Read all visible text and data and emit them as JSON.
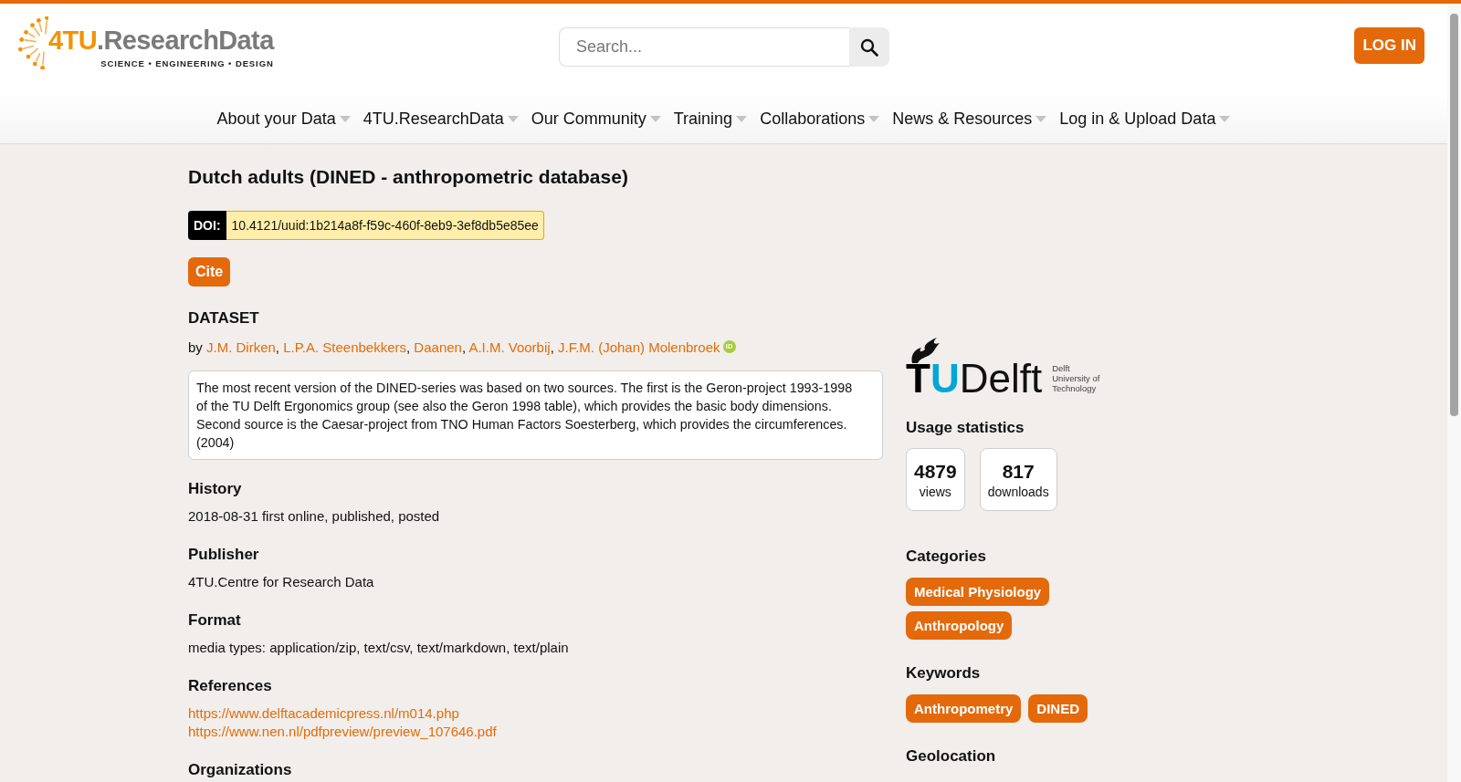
{
  "header": {
    "logo": {
      "mark": "4TU",
      "name": ".ResearchData",
      "tagline": "SCIENCE • ENGINEERING • DESIGN"
    },
    "search": {
      "placeholder": "Search..."
    },
    "login_button": "LOG IN"
  },
  "nav_menu": [
    "About your Data",
    "4TU.ResearchData",
    "Our Community",
    "Training",
    "Collaborations",
    "News & Resources",
    "Log in & Upload Data"
  ],
  "dataset": {
    "title": "Dutch adults (DINED - anthropometric database)",
    "doi": {
      "label": "DOI:",
      "value": "10.4121/uuid:1b214a8f-f59c-460f-8eb9-3ef8db5e85ee"
    },
    "cite_button": "Cite",
    "type_heading": "DATASET",
    "byline": {
      "prefix": "by",
      "separator": ",",
      "authors": [
        {
          "name": "J.M. Dirken"
        },
        {
          "name": "L.P.A. Steenbekkers"
        },
        {
          "name": "Daanen"
        },
        {
          "name": "A.I.M. Voorbij"
        },
        {
          "name": "J.F.M. (Johan) Molenbroek",
          "orcid_badge": "iD"
        }
      ]
    },
    "description": "The most recent version of the DINED-series was based on two sources. The first is the Geron-project 1993-1998 of the TU Delft Ergonomics group (see also the Geron 1998 table), which provides the basic body dimensions. Second source is the Caesar-project from TNO Human Factors Soesterberg, which provides the circumferences. (2004)",
    "sections": [
      {
        "kind": "text",
        "heading": "History",
        "text": "2018-08-31 first online, published, posted"
      },
      {
        "kind": "text",
        "heading": "Publisher",
        "text": "4TU.Centre for Research Data"
      },
      {
        "kind": "text",
        "heading": "Format",
        "text": "media types: application/zip, text/csv, text/markdown, text/plain"
      },
      {
        "kind": "links",
        "heading": "References",
        "links": [
          "https://www.delftacademicpress.nl/m014.php",
          "https://www.nen.nl/pdfpreview/preview_107646.pdf"
        ]
      },
      {
        "kind": "heading",
        "heading": "Organizations"
      }
    ]
  },
  "sidebar": {
    "institution_logo": {
      "initials_dark": "T",
      "initials_accent": "U",
      "name": "Delft",
      "subtitle_lines": [
        "Delft",
        "University of",
        "Technology"
      ]
    },
    "sections": [
      {
        "kind": "stats",
        "heading": "Usage statistics",
        "stats": [
          {
            "value": "4879",
            "label": "views"
          },
          {
            "value": "817",
            "label": "downloads"
          }
        ]
      },
      {
        "kind": "tags",
        "heading": "Categories",
        "tags": [
          "Medical Physiology",
          "Anthropology"
        ]
      },
      {
        "kind": "tags",
        "heading": "Keywords",
        "tags": [
          "Anthropometry",
          "DINED"
        ]
      },
      {
        "kind": "heading",
        "heading": "Geolocation"
      }
    ]
  }
}
